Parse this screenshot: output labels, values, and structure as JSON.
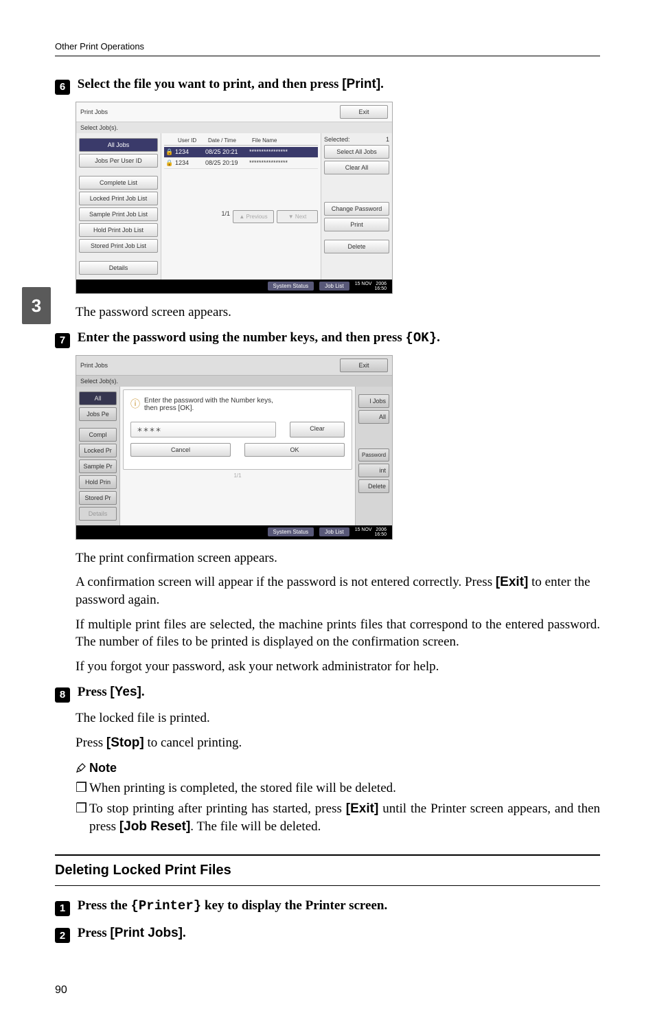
{
  "running_head": "Other Print Operations",
  "side_tab": "3",
  "step6": {
    "num": "6",
    "text_before": "Select the file you want to print, and then press ",
    "btn": "[Print]",
    "after": "."
  },
  "panel1": {
    "title": "Print Jobs",
    "exit": "Exit",
    "subhead": "Select Job(s).",
    "left": {
      "all_jobs": "All Jobs",
      "per_user": "Jobs Per User ID",
      "complete": "Complete List",
      "locked": "Locked Print Job List",
      "sample": "Sample Print Job List",
      "hold": "Hold Print Job List",
      "stored": "Stored Print Job List",
      "details": "Details"
    },
    "cols": {
      "user": "User ID",
      "dt": "Date / Time",
      "file": "File Name"
    },
    "rows": [
      {
        "icon": "🔒",
        "user": "1234",
        "dt": "08/25 20:21",
        "file": "****************"
      },
      {
        "icon": "🔒",
        "user": "1234",
        "dt": "08/25 20:19",
        "file": "****************"
      }
    ],
    "pager": "1/1",
    "prev": "▲ Previous",
    "next": "▼ Next",
    "right": {
      "sel_label": "Selected:",
      "sel_count": "1",
      "select_all": "Select All Jobs",
      "clear_all": "Clear All",
      "change_pw": "Change Password",
      "print": "Print",
      "delete": "Delete"
    },
    "footer": {
      "sys": "System Status",
      "joblist": "Job List",
      "dt": "15 NOV   2006\n16:50"
    }
  },
  "after6": "The password screen appears.",
  "step7": {
    "num": "7",
    "text_before": "Enter the password using the number keys, and then press ",
    "btn": "{OK}",
    "after": "."
  },
  "panel2": {
    "title": "Print Jobs",
    "exit": "Exit",
    "subhead": "Select Job(s).",
    "modal_icon": "ⓘ",
    "modal_text": "Enter the password with the Number keys,\nthen press [OK].",
    "stars": "＊＊＊＊",
    "clear": "Clear",
    "cancel": "Cancel",
    "ok": "OK",
    "left": {
      "all": "All",
      "jobs_pe": "Jobs Pe",
      "compl": "Compl",
      "locked": "Locked Pr",
      "sample": "Sample Pr",
      "hold": "Hold Prin",
      "stored": "Stored Pr",
      "details": "Details"
    },
    "right": {
      "jobs": "l Jobs",
      "all": "All",
      "password": "Password",
      "int": "int",
      "delete": "Delete"
    },
    "pager": "1/1",
    "footer": {
      "sys": "System Status",
      "joblist": "Job List",
      "dt": "15 NOV   2006\n16:50"
    }
  },
  "after7a": "The print confirmation screen appears.",
  "after7b_1": "A confirmation screen will appear if the password is not entered correctly. Press ",
  "after7b_btn": "[Exit]",
  "after7b_2": " to enter the password again.",
  "after7c": "If multiple print files are selected, the machine prints files that correspond to the entered password. The number of files to be printed is displayed on the confirmation screen.",
  "after7d": "If you forgot your password, ask your network administrator for help.",
  "step8": {
    "num": "8",
    "text_before": "Press ",
    "btn": "[Yes]",
    "after": "."
  },
  "after8a": "The locked file is printed.",
  "after8b_1": "Press ",
  "after8b_btn": "[Stop]",
  "after8b_2": " to cancel printing.",
  "note_label": "Note",
  "note1": "When printing is completed, the stored file will be deleted.",
  "note2_1": "To stop printing after printing has started, press ",
  "note2_btn1": "[Exit]",
  "note2_2": " until the Printer screen appears, and then press ",
  "note2_btn2": "[Job Reset]",
  "note2_3": ". The file will be deleted.",
  "section_title": "Deleting Locked Print Files",
  "stepA": {
    "num": "1",
    "text_before": "Press the ",
    "btn": "{Printer}",
    "after": " key to display the Printer screen."
  },
  "stepB": {
    "num": "2",
    "text_before": "Press ",
    "btn": "[Print Jobs]",
    "after": "."
  },
  "page_number": "90"
}
